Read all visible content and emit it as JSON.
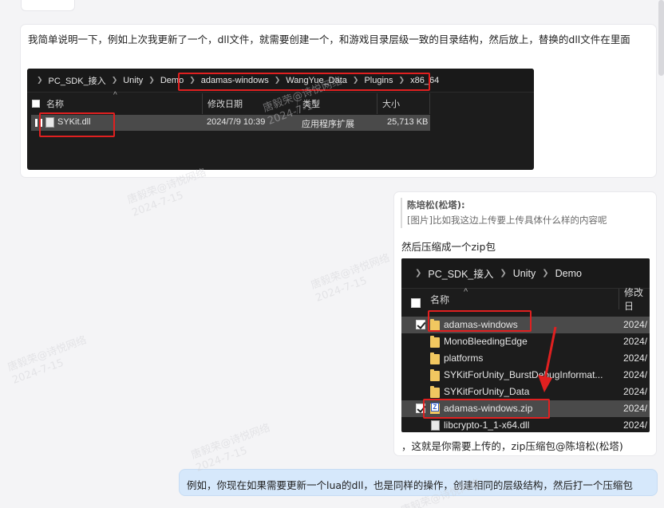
{
  "message1": {
    "text": "我简单说明一下，例如上次我更新了一个，dll文件，就需要创建一个，和游戏目录层级一致的目录结构，然后放上，替换的dll文件在里面"
  },
  "explorer1": {
    "path": [
      "PC_SDK_接入",
      "Unity",
      "Demo",
      "adamas-windows",
      "WangYue_Data",
      "Plugins",
      "x86_64"
    ],
    "columns": [
      "名称",
      "修改日期",
      "类型",
      "大小"
    ],
    "rows": [
      {
        "name": "SYKit.dll",
        "date": "2024/7/9 10:39",
        "type": "应用程序扩展",
        "size": "25,713 KB"
      }
    ]
  },
  "message2": {
    "quote_author": "陈培松(松塔):",
    "quote_text": "[图片]比如我这边上传要上传具体什么样的内容呢",
    "text1": "然后压缩成一个zip包",
    "text2": "，这就是你需要上传的，zip压缩包@陈培松(松塔)"
  },
  "explorer2": {
    "path": [
      "PC_SDK_接入",
      "Unity",
      "Demo"
    ],
    "columns": [
      "名称",
      "修改日"
    ],
    "rows": [
      {
        "name": "adamas-windows",
        "date": "2024/",
        "checked": true,
        "selected": true,
        "icon": "folder-icon"
      },
      {
        "name": "MonoBleedingEdge",
        "date": "2024/",
        "checked": false,
        "selected": false,
        "icon": "folder-icon"
      },
      {
        "name": "platforms",
        "date": "2024/",
        "checked": false,
        "selected": false,
        "icon": "folder-icon"
      },
      {
        "name": "SYKitForUnity_BurstDebugInformat...",
        "date": "2024/",
        "checked": false,
        "selected": false,
        "icon": "folder-icon"
      },
      {
        "name": "SYKitForUnity_Data",
        "date": "2024/",
        "checked": false,
        "selected": false,
        "icon": "folder-icon"
      },
      {
        "name": "adamas-windows.zip",
        "date": "2024/",
        "checked": true,
        "selected": true,
        "icon": "zip-icon"
      },
      {
        "name": "libcrypto-1_1-x64.dll",
        "date": "2024/",
        "checked": false,
        "selected": false,
        "icon": "file-icon"
      }
    ]
  },
  "message3": {
    "text": "例如，你现在如果需要更新一个lua的dll，也是同样的操作，创建相同的层级结构，然后打一个压缩包"
  },
  "watermark": {
    "name": "唐毅荣@诗悦网络",
    "date": "2024-7-15"
  },
  "colors": {
    "annotation_red": "#e02020",
    "self_bubble": "#d6e8fb",
    "explorer_bg": "#1c1c1c",
    "folder": "#f1c760"
  }
}
